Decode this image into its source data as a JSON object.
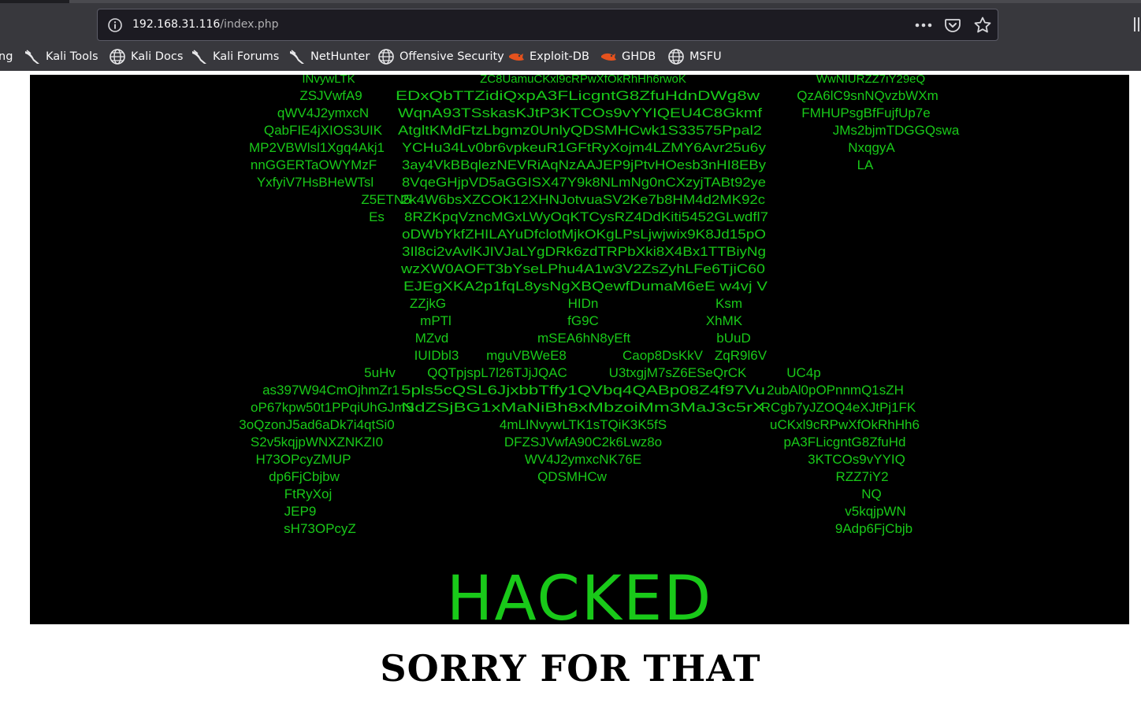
{
  "browser": {
    "url_host": "192.168.31.116",
    "url_path": "/index.php",
    "bookmarks": [
      {
        "label": "ng",
        "icon": "none"
      },
      {
        "label": "Kali Tools",
        "icon": "kali-dragon-icon"
      },
      {
        "label": "Kali Docs",
        "icon": "globe-icon"
      },
      {
        "label": "Kali Forums",
        "icon": "kali-dragon-icon"
      },
      {
        "label": "NetHunter",
        "icon": "kali-dragon-icon"
      },
      {
        "label": "Offensive Security",
        "icon": "globe-icon"
      },
      {
        "label": "Exploit-DB",
        "icon": "exploit-db-icon"
      },
      {
        "label": "GHDB",
        "icon": "exploit-db-icon"
      },
      {
        "label": "MSFU",
        "icon": "globe-icon"
      }
    ]
  },
  "page": {
    "banner_text": "HACKED",
    "banner_color": "#19c919",
    "heading": "SORRY FOR THAT",
    "code_lines": [
      "INvywLTK",
      "ZSJVwfA9",
      "qWV4J2ymxcN",
      "QabFIE4jXIOS3UIK",
      "MP2VBWlsl1Xgq4Akj1",
      "nnGGERTaOWYMzF",
      "YxfyiV7HsBHeWTsl",
      "Z5ETN5",
      "Es",
      "ZC8UamuCKxl9cRPwXfOkRhHh6rwoK",
      "EDxQbTTZidiQxpA3FLicgntG8ZfuHdnDWg8w",
      "WqnA93TSskasKJtP3KTCOs9vYYIQEU4C8Gkmf",
      "AtgltKMdFtzLbgmz0UnlyQDSMHCwk1S33575Ppal2",
      "YCHu34Lv0br6vpkeuR1GFtRyXojm4LZMY6Avr25u6y",
      "3ay4VkBBqlezNEVRiAqNzAAJEP9jPtvHOesb3nHI8EBy",
      "8VqeGHjpVD5aGGISX47Y9k8NLmNg0nCXzyjTABt92ye",
      "2k4W6bsXZCOK12XHNJotvuaSV2Ke7b8HM4d2MK92c",
      "8RZKpqVzncMGxLWyOqKTCysRZ4DdKiti5452GLwdfl7",
      "oDWbYkfZHILAYuDfclotMjkOKgLPsLjwjwix9K8Jd15pO",
      "3Il8ci2vAvlKJIVJaLYgDRk6zdTRPbXki8X4Bx1TTBiyNg",
      "wzXW0AOFT3bYseLPhu4A1w3V2ZsZyhLFe6TjiC60",
      "EJEgXKA2p1fqL8ysNgXBQewfDumaM6eE w4vj V",
      "ZZjkG",
      "HIDn",
      "Ksm",
      "mPTl",
      "fG9C",
      "XhMK",
      "MZvd",
      "mSEA6hN8yEft",
      "bUuD",
      "IUIDbl3",
      "mguVBWeE8",
      "Caop8DsKkV",
      "ZqR9l6V",
      "5uHv",
      "QQTpjspL7l26TJjJQAC",
      "U3txgjM7sZ6ESeQrCK",
      "UC4p",
      "as397W94CmOjhmZr1",
      "5pls5cQSL6JjxbbTffy1QVbq4QABp08Z4f97Vu",
      "2ubAl0pOPnnmQ1sZH",
      "oP67kpw50t1PPqiUhGJmS",
      "NdZSjBG1xMaNiBh8xMbzoiMm3MaJ3c5rX",
      "RCgb7yJZOQ4eXJtPj1FK",
      "3oQzonJ5ad6aDk7i4qtSi0",
      "4mLINvywLTK1sTQiK3K5fS",
      "uCKxl9cRPwXfOkRhHh6",
      "S2v5kqjpWNXZNKZI0",
      "DFZSJVwfA90C2k6Lwz8o",
      "pA3FLicgntG8ZfuHd",
      "H73OPcyZMUP",
      "WV4J2ymxcNK76E",
      "3KTCOs9vYYIQ",
      "dp6FjCbjbw",
      "QDSMHCw",
      "RZZ7iY2",
      "FtRyXoj",
      "NQ",
      "JEP9",
      "v5kqjpWN",
      "sH73OPcyZ",
      "9Adp6FjCbjb",
      "WwNIURZZ7iY29eQ",
      "QzA6lC9snNQvzbWXm",
      "FMHUPsgBfFujfUp7e",
      "JMs2bjmTDGGQswa",
      "NxqgyA",
      "LA"
    ]
  }
}
